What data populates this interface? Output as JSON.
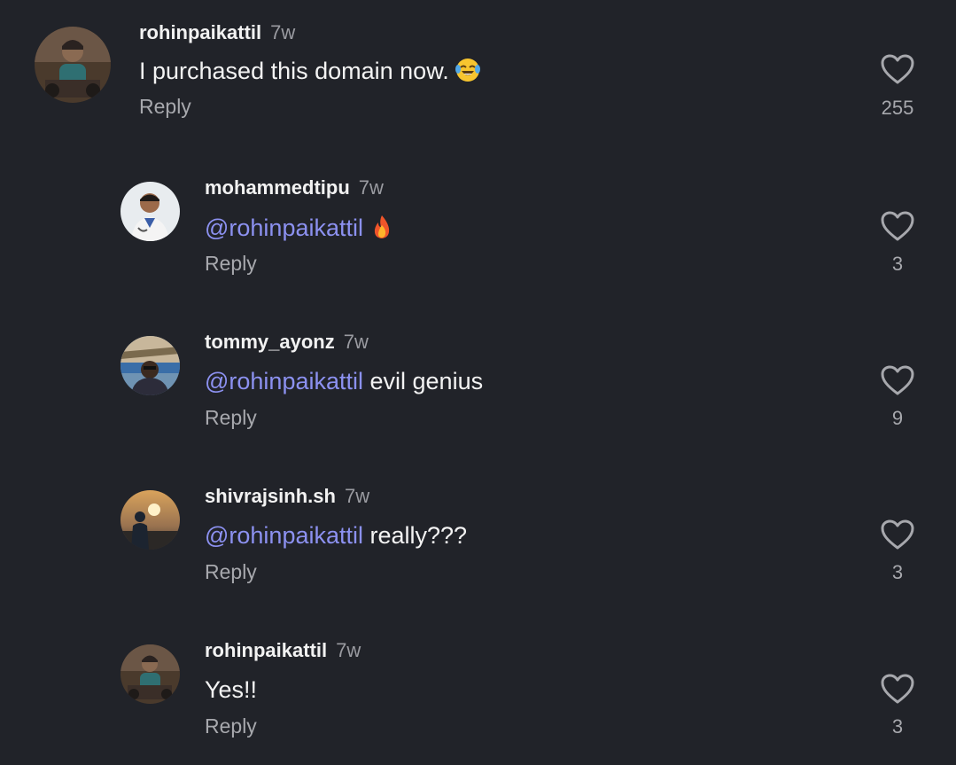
{
  "comments": [
    {
      "username": "rohinpaikattil",
      "time": "7w",
      "mention": "",
      "text": "I purchased this domain now.",
      "emoji": "laughing-tears-emoji",
      "reply_label": "Reply",
      "likes": "255"
    },
    {
      "username": "mohammedtipu",
      "time": "7w",
      "mention": "@rohinpaikattil",
      "text": "",
      "emoji": "fire-emoji",
      "reply_label": "Reply",
      "likes": "3"
    },
    {
      "username": "tommy_ayonz",
      "time": "7w",
      "mention": "@rohinpaikattil",
      "text": " evil genius",
      "emoji": "",
      "reply_label": "Reply",
      "likes": "9"
    },
    {
      "username": "shivrajsinh.sh",
      "time": "7w",
      "mention": "@rohinpaikattil",
      "text": " really???",
      "emoji": "",
      "reply_label": "Reply",
      "likes": "3"
    },
    {
      "username": "rohinpaikattil",
      "time": "7w",
      "mention": "",
      "text": "Yes!!",
      "emoji": "",
      "reply_label": "Reply",
      "likes": "3"
    }
  ],
  "colors": {
    "background": "#212329",
    "mention": "#8c91f0",
    "secondary_text": "#a7a8ad"
  }
}
